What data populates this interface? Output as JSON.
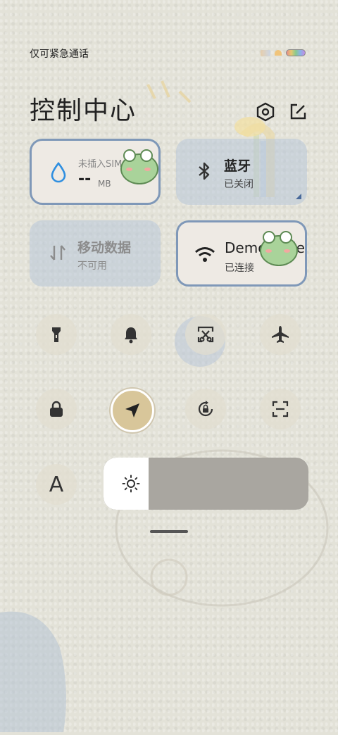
{
  "status_bar": {
    "carrier_text": "仅可紧急通话"
  },
  "header": {
    "title": "控制中心",
    "settings_icon": "settings-hexagon-icon",
    "edit_icon": "edit-icon"
  },
  "tiles": {
    "data": {
      "top_label": "未插入SIM卡",
      "value": "--",
      "unit": "MB",
      "icon": "water-drop-icon",
      "active": true
    },
    "bluetooth": {
      "title": "蓝牙",
      "status": "已关闭",
      "icon": "bluetooth-icon",
      "active": false
    },
    "mobile_data": {
      "title": "移动数据",
      "status": "不可用",
      "icon": "mobile-data-icon",
      "active": false
    },
    "wifi": {
      "title": "DemoMode",
      "status": "已连接",
      "icon": "wifi-icon",
      "active": true
    }
  },
  "toggles_row1": [
    {
      "name": "flashlight",
      "icon": "flashlight-icon"
    },
    {
      "name": "ring",
      "icon": "bell-icon"
    },
    {
      "name": "screenshot",
      "icon": "screenshot-icon"
    },
    {
      "name": "airplane",
      "icon": "airplane-icon"
    }
  ],
  "toggles_row2": [
    {
      "name": "lock-screen",
      "icon": "lock-icon"
    },
    {
      "name": "location",
      "icon": "location-arrow-icon",
      "active": true
    },
    {
      "name": "rotation-lock",
      "icon": "rotation-lock-icon"
    },
    {
      "name": "scan",
      "icon": "scan-icon"
    }
  ],
  "font_button": {
    "label": "A",
    "icon": "font-size-icon"
  },
  "brightness": {
    "level": 0.22,
    "icon": "sun-icon"
  },
  "colors": {
    "active_border": "#7f98b8",
    "inactive_tile": "#b8c6d8",
    "location_active": "#d8c69a"
  }
}
